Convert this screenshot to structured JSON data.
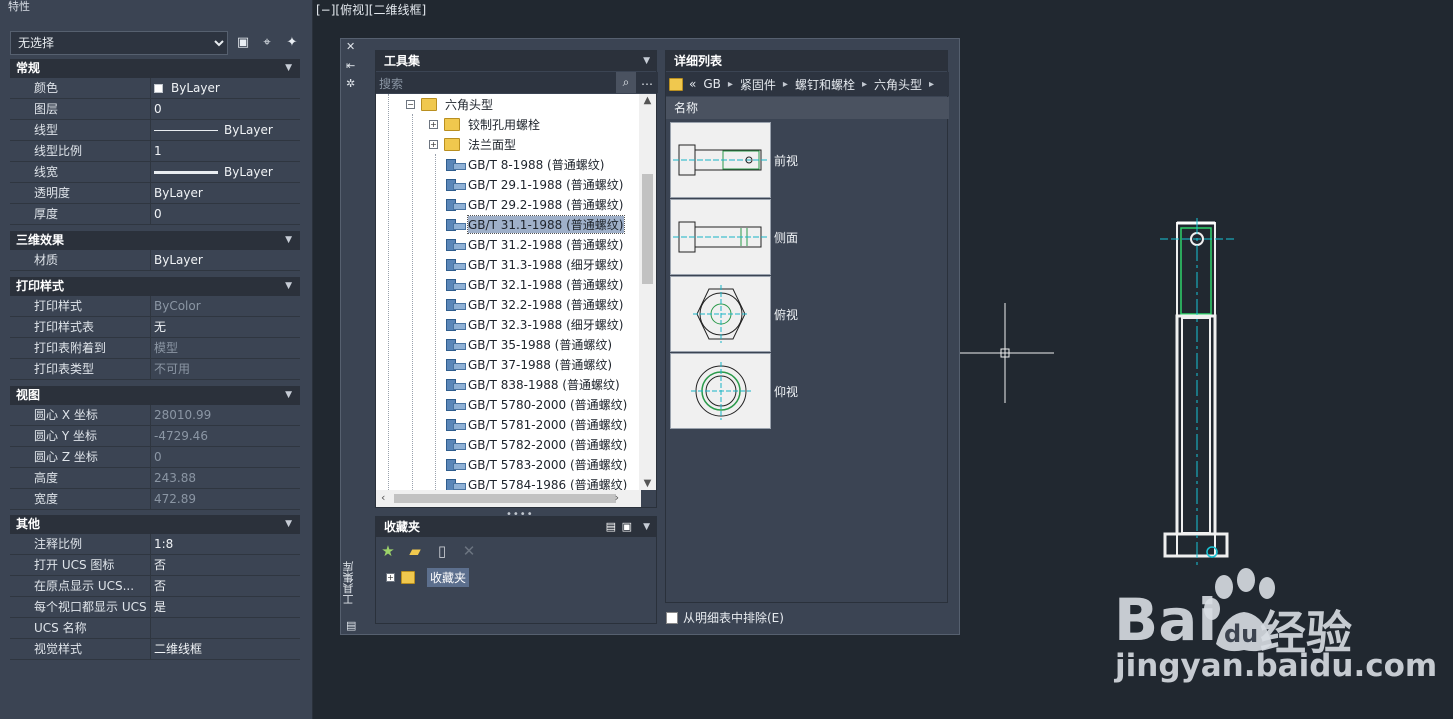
{
  "properties": {
    "title": "特性",
    "selection": "无选择",
    "sections": [
      {
        "name": "常规",
        "rows": [
          {
            "key": "颜色",
            "value": "ByLayer",
            "swatch": true
          },
          {
            "key": "图层",
            "value": "0"
          },
          {
            "key": "线型",
            "value": "ByLayer",
            "line": "thin"
          },
          {
            "key": "线型比例",
            "value": "1"
          },
          {
            "key": "线宽",
            "value": "ByLayer",
            "line": "thick"
          },
          {
            "key": "透明度",
            "value": "ByLayer"
          },
          {
            "key": "厚度",
            "value": "0"
          }
        ]
      },
      {
        "name": "三维效果",
        "rows": [
          {
            "key": "材质",
            "value": "ByLayer"
          }
        ]
      },
      {
        "name": "打印样式",
        "rows": [
          {
            "key": "打印样式",
            "value": "ByColor",
            "dim": true
          },
          {
            "key": "打印样式表",
            "value": "无"
          },
          {
            "key": "打印表附着到",
            "value": "模型",
            "dim": true
          },
          {
            "key": "打印表类型",
            "value": "不可用",
            "dim": true
          }
        ]
      },
      {
        "name": "视图",
        "rows": [
          {
            "key": "圆心 X 坐标",
            "value": "28010.99",
            "dim": true
          },
          {
            "key": "圆心 Y 坐标",
            "value": "-4729.46",
            "dim": true
          },
          {
            "key": "圆心 Z 坐标",
            "value": "0",
            "dim": true
          },
          {
            "key": "高度",
            "value": "243.88",
            "dim": true
          },
          {
            "key": "宽度",
            "value": "472.89",
            "dim": true
          }
        ]
      },
      {
        "name": "其他",
        "rows": [
          {
            "key": "注释比例",
            "value": "1:8"
          },
          {
            "key": "打开 UCS 图标",
            "value": "否"
          },
          {
            "key": "在原点显示 UCS...",
            "value": "否"
          },
          {
            "key": "每个视口都显示 UCS",
            "value": "是"
          },
          {
            "key": "UCS 名称",
            "value": ""
          },
          {
            "key": "视觉样式",
            "value": "二维线框"
          }
        ]
      }
    ]
  },
  "viewport_label": "[−][俯视][二维线框]",
  "tool_palette": {
    "vertical_title": "工具集库",
    "toolset": {
      "title": "工具集",
      "search_placeholder": "搜索",
      "tree": [
        {
          "label": "六角头型",
          "type": "folder",
          "level": 0,
          "expander": "⊟"
        },
        {
          "label": "铰制孔用螺栓",
          "type": "folder",
          "level": 1,
          "expander": "⊞"
        },
        {
          "label": "法兰面型",
          "type": "folder",
          "level": 1,
          "expander": "⊞"
        },
        {
          "label": "GB/T 8-1988  (普通螺纹)",
          "type": "item",
          "level": 1
        },
        {
          "label": "GB/T 29.1-1988  (普通螺纹)",
          "type": "item",
          "level": 1
        },
        {
          "label": "GB/T 29.2-1988  (普通螺纹)",
          "type": "item",
          "level": 1
        },
        {
          "label": "GB/T 31.1-1988  (普通螺纹)",
          "type": "item",
          "level": 1,
          "selected": true
        },
        {
          "label": "GB/T 31.2-1988  (普通螺纹)",
          "type": "item",
          "level": 1
        },
        {
          "label": "GB/T 31.3-1988  (细牙螺纹)",
          "type": "item",
          "level": 1
        },
        {
          "label": "GB/T 32.1-1988  (普通螺纹)",
          "type": "item",
          "level": 1
        },
        {
          "label": "GB/T 32.2-1988  (普通螺纹)",
          "type": "item",
          "level": 1
        },
        {
          "label": "GB/T 32.3-1988  (细牙螺纹)",
          "type": "item",
          "level": 1
        },
        {
          "label": "GB/T 35-1988  (普通螺纹)",
          "type": "item",
          "level": 1
        },
        {
          "label": "GB/T 37-1988  (普通螺纹)",
          "type": "item",
          "level": 1
        },
        {
          "label": "GB/T 838-1988  (普通螺纹)",
          "type": "item",
          "level": 1
        },
        {
          "label": "GB/T 5780-2000  (普通螺纹)",
          "type": "item",
          "level": 1
        },
        {
          "label": "GB/T 5781-2000  (普通螺纹)",
          "type": "item",
          "level": 1
        },
        {
          "label": "GB/T 5782-2000  (普通螺纹)",
          "type": "item",
          "level": 1
        },
        {
          "label": "GB/T 5783-2000  (普通螺纹)",
          "type": "item",
          "level": 1
        },
        {
          "label": "GB/T 5784-1986  (普通螺纹)",
          "type": "item",
          "level": 1
        }
      ]
    },
    "favorites": {
      "title": "收藏夹",
      "item": "收藏夹"
    },
    "detail": {
      "title": "详细列表",
      "breadcrumb": [
        "«",
        "GB",
        "紧固件",
        "螺钉和螺栓",
        "六角头型"
      ],
      "column": "名称",
      "views": [
        "前视",
        "侧面",
        "俯视",
        "仰视"
      ],
      "exclude_label": "从明细表中排除(E)"
    }
  },
  "watermark": {
    "brand": "经验",
    "url": "jingyan.baidu.com"
  }
}
